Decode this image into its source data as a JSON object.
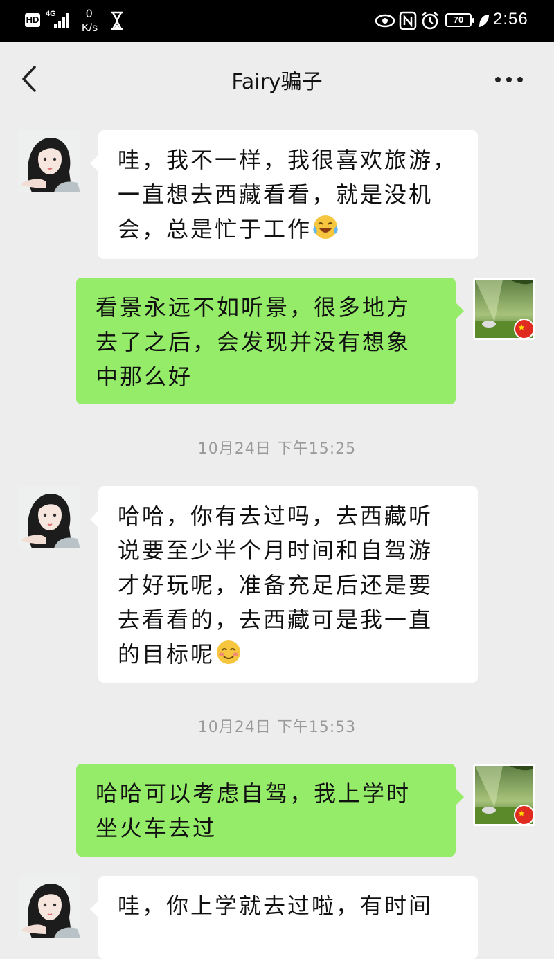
{
  "status_bar": {
    "hd": "HD",
    "network": "4G",
    "speed_value": "0",
    "speed_unit": "K/s",
    "battery": "70",
    "time": "2:56"
  },
  "nav": {
    "title": "Fairy骗子"
  },
  "messages": [
    {
      "sender": "contact",
      "lines": [
        "哇，我不一样，我很喜欢旅游，",
        "一直想去西藏看看，就是没机",
        "会，总是忙于工作"
      ],
      "emoji": "crying-laughing-emoji"
    },
    {
      "sender": "self",
      "lines": [
        "看景永远不如听景，很多地方",
        "去了之后，会发现并没有想象",
        "中那么好"
      ]
    },
    {
      "timestamp": "10月24日 下午15:25"
    },
    {
      "sender": "contact",
      "lines": [
        "哈哈，你有去过吗，去西藏听",
        "说要至少半个月时间和自驾游",
        "才好玩呢，准备充足后还是要",
        "去看看的，去西藏可是我一直",
        "的目标呢"
      ],
      "emoji": "smiling-blush-emoji"
    },
    {
      "timestamp": "10月24日 下午15:53"
    },
    {
      "sender": "self",
      "lines": [
        "哈哈可以考虑自驾，我上学时",
        "坐火车去过"
      ]
    },
    {
      "sender": "contact",
      "lines": [
        "哇，你上学就去过啦，有时间"
      ]
    }
  ]
}
